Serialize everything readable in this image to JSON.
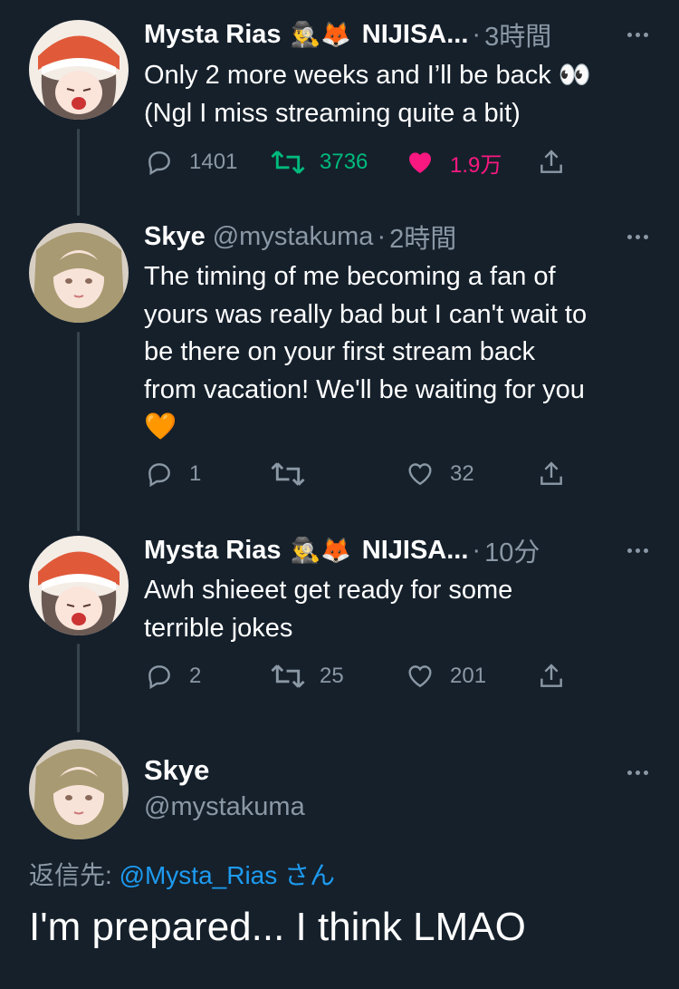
{
  "tweets": [
    {
      "name": "Mysta Rias",
      "badges": "🕵️‍♂️🦊",
      "extra": "NIJISA...",
      "handle": "",
      "time": "3時間",
      "lines": [
        "Only 2 more weeks and I’ll be back 👀",
        "(Ngl I miss streaming quite a bit)"
      ],
      "replies": "1401",
      "retweets": "3736",
      "likes": "1.9万",
      "liked": true,
      "retweeted": true
    },
    {
      "name": "Skye",
      "badges": "",
      "extra": "",
      "handle": "@mystakuma",
      "time": "2時間",
      "lines": [
        "The timing of me becoming a fan of",
        "yours was really bad but I can't wait to",
        "be there on your first stream back",
        "from vacation! We'll be waiting for you",
        "🧡"
      ],
      "replies": "1",
      "retweets": "",
      "likes": "32",
      "liked": false,
      "retweeted": false
    },
    {
      "name": "Mysta Rias",
      "badges": "🕵️‍♂️🦊",
      "extra": "NIJISA...",
      "handle": "",
      "time": "10分",
      "lines": [
        "Awh shieeet get ready for some",
        "terrible jokes"
      ],
      "replies": "2",
      "retweets": "25",
      "likes": "201",
      "liked": false,
      "retweeted": false
    }
  ],
  "main": {
    "name": "Skye",
    "handle": "@mystakuma",
    "reply_prefix": "返信先: ",
    "reply_mention": "@Mysta_Rias",
    "reply_suffix": " さん",
    "text": "I'm prepared... I think LMAO"
  },
  "colors": {
    "background": "#15202b",
    "muted": "#8b98a5",
    "retweet_active": "#00ba7c",
    "like_active": "#f91880",
    "link": "#1d9bf0"
  },
  "icons": [
    "reply-icon",
    "retweet-icon",
    "like-icon",
    "share-icon",
    "more-icon"
  ]
}
